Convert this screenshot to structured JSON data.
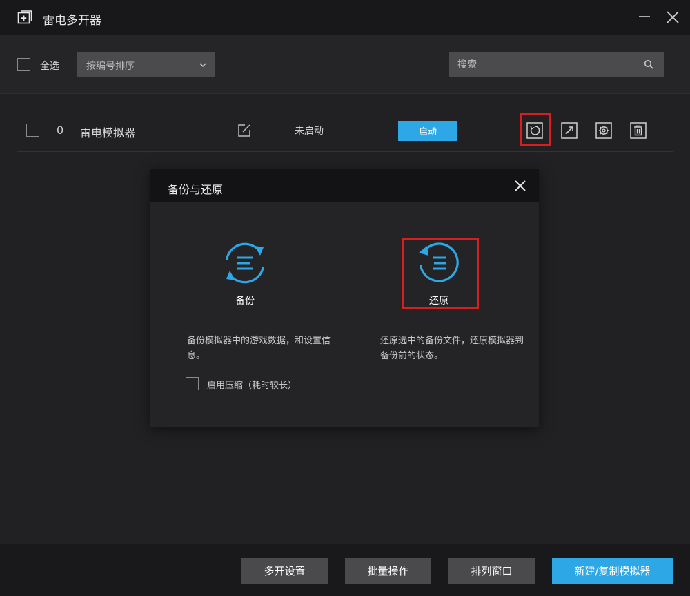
{
  "window": {
    "title": "雷电多开器",
    "icon": "add-window-icon",
    "controls": [
      "minimize-icon",
      "close-icon"
    ]
  },
  "toolbar": {
    "select_all_label": "全选",
    "sort_select": {
      "selected": "按编号排序",
      "icon": "chevron-down-icon"
    },
    "search": {
      "placeholder": "搜索",
      "value": "",
      "icon": "search-icon"
    }
  },
  "emulators": [
    {
      "index": "0",
      "name": "雷电模拟器",
      "status": "未启动",
      "start_label": "启动",
      "actions": [
        "backup-restore-icon",
        "export-icon",
        "settings-icon",
        "delete-icon"
      ]
    }
  ],
  "dialog": {
    "title": "备份与还原",
    "backup": {
      "label": "备份",
      "description": "备份模拟器中的游戏数据，和设置信息。",
      "compress_label": "启用压缩（耗时较长）"
    },
    "restore": {
      "label": "还原",
      "description": "还原选中的备份文件，还原模拟器到备份前的状态。"
    }
  },
  "bottom": {
    "multi_settings": "多开设置",
    "batch_ops": "批量操作",
    "arrange_windows": "排列窗口",
    "new_copy": "新建/复制模拟器"
  },
  "colors": {
    "accent": "#2ea7e6",
    "highlight": "#d81e1e",
    "background": "#212124",
    "titlebar": "#18181a"
  }
}
